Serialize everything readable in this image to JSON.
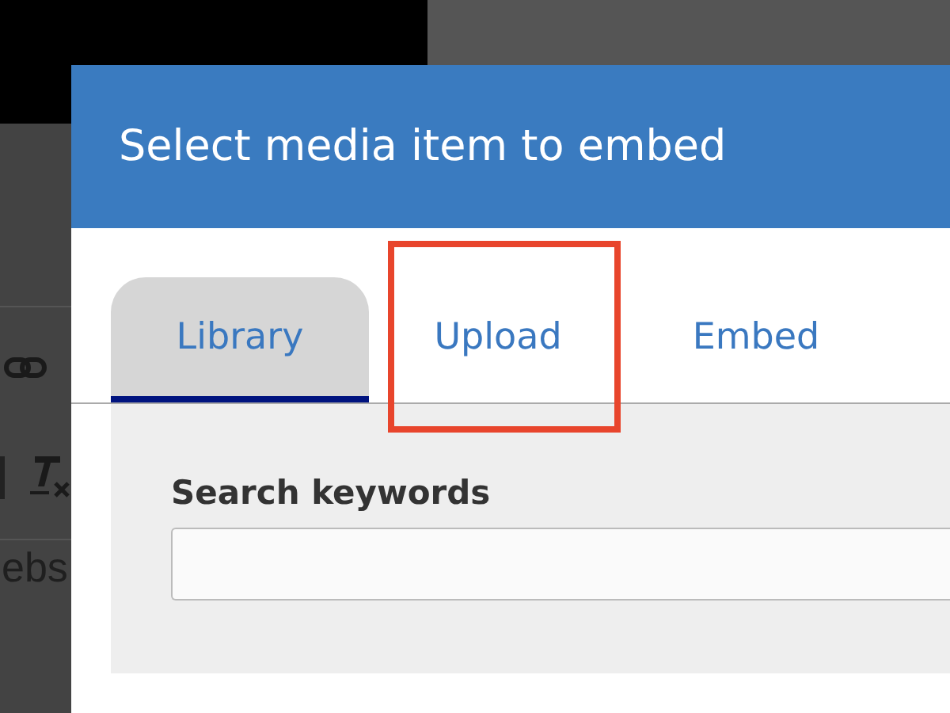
{
  "background_editor": {
    "text_fragment": "ebs"
  },
  "dialog": {
    "title": "Select media item to embed",
    "tabs": [
      {
        "label": "Library",
        "selected": true,
        "highlighted": false
      },
      {
        "label": "Upload",
        "selected": false,
        "highlighted": true
      },
      {
        "label": "Embed",
        "selected": false,
        "highlighted": false
      }
    ],
    "search": {
      "label": "Search keywords"
    }
  }
}
